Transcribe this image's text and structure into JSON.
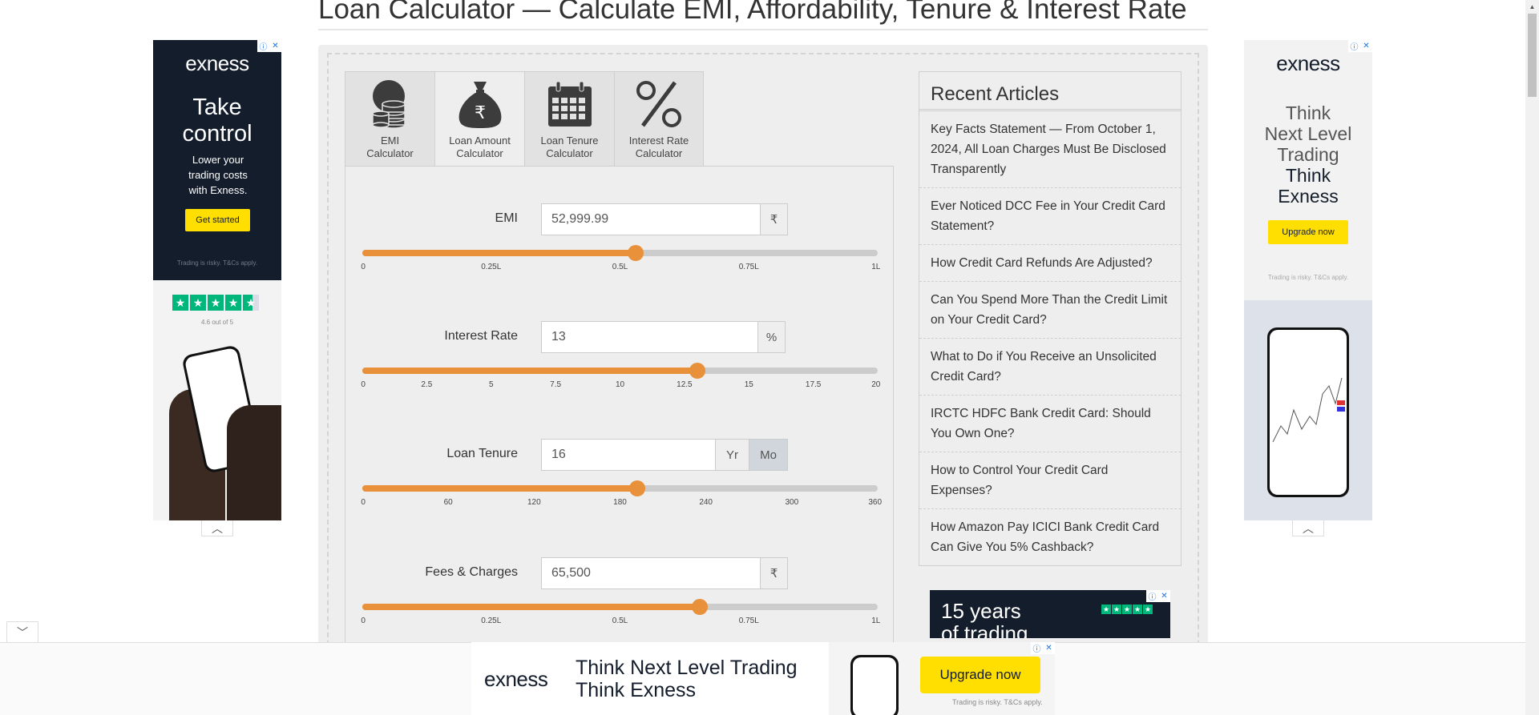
{
  "page": {
    "title": "Loan Calculator — Calculate EMI, Affordability, Tenure & Interest Rate"
  },
  "tabs": [
    {
      "label_line1": "EMI",
      "label_line2": "Calculator",
      "icon": "coins-icon",
      "active": false
    },
    {
      "label_line1": "Loan Amount",
      "label_line2": "Calculator",
      "icon": "money-bag-icon",
      "active": true
    },
    {
      "label_line1": "Loan Tenure",
      "label_line2": "Calculator",
      "icon": "calendar-icon",
      "active": false
    },
    {
      "label_line1": "Interest Rate",
      "label_line2": "Calculator",
      "icon": "percent-icon",
      "active": false
    }
  ],
  "calculator": {
    "emi": {
      "label": "EMI",
      "value": "52,999.99",
      "unit": "₹",
      "slider_fraction": 0.53,
      "ticks": [
        "0",
        "0.25L",
        "0.5L",
        "0.75L",
        "1L"
      ]
    },
    "interest_rate": {
      "label": "Interest Rate",
      "value": "13",
      "unit": "%",
      "slider_fraction": 0.65,
      "ticks": [
        "0",
        "2.5",
        "5",
        "7.5",
        "10",
        "12.5",
        "15",
        "17.5",
        "20"
      ]
    },
    "loan_tenure": {
      "label": "Loan Tenure",
      "value": "16",
      "unit_year": "Yr",
      "unit_month": "Mo",
      "selected_unit": "Mo",
      "slider_fraction": 0.533,
      "ticks": [
        "0",
        "60",
        "120",
        "180",
        "240",
        "300",
        "360"
      ]
    },
    "fees": {
      "label": "Fees & Charges",
      "value": "65,500",
      "unit": "₹",
      "slider_fraction": 0.655,
      "ticks": [
        "0",
        "0.25L",
        "0.5L",
        "0.75L",
        "1L"
      ]
    }
  },
  "articles": {
    "title": "Recent Articles",
    "items": [
      "Key Facts Statement — From October 1, 2024, All Loan Charges Must Be Disclosed Transparently",
      "Ever Noticed DCC Fee in Your Credit Card Statement?",
      "How Credit Card Refunds Are Adjusted?",
      "Can You Spend More Than the Credit Limit on Your Credit Card?",
      "What to Do if You Receive an Unsolicited Credit Card?",
      "IRCTC HDFC Bank Credit Card: Should You Own One?",
      "How to Control Your Credit Card Expenses?",
      "How Amazon Pay ICICI Bank Credit Card Can Give You 5% Cashback?"
    ]
  },
  "ads": {
    "brand": "exness",
    "left": {
      "headline1": "Take",
      "headline2": "control",
      "body": "Lower your trading costs with Exness.",
      "cta": "Get started",
      "disclaimer": "Trading is risky. T&Cs apply.",
      "rating": "4.6 out of 5"
    },
    "right": {
      "line1": "Think",
      "line2": "Next Level",
      "line3": "Trading",
      "line4": "Think",
      "line5": "Exness",
      "cta": "Upgrade now",
      "disclaimer": "Trading is risky. T&Cs apply."
    },
    "inline": {
      "line1": "15 years",
      "line2": "of trading"
    },
    "bottom": {
      "line1": "Think Next Level Trading",
      "line2": "Think Exness",
      "cta": "Upgrade now",
      "disclaimer": "Trading is risky. T&Cs apply."
    }
  },
  "colors": {
    "accent": "#e8913a",
    "ad_dark": "#141d2b",
    "ad_yellow": "#ffde02"
  }
}
